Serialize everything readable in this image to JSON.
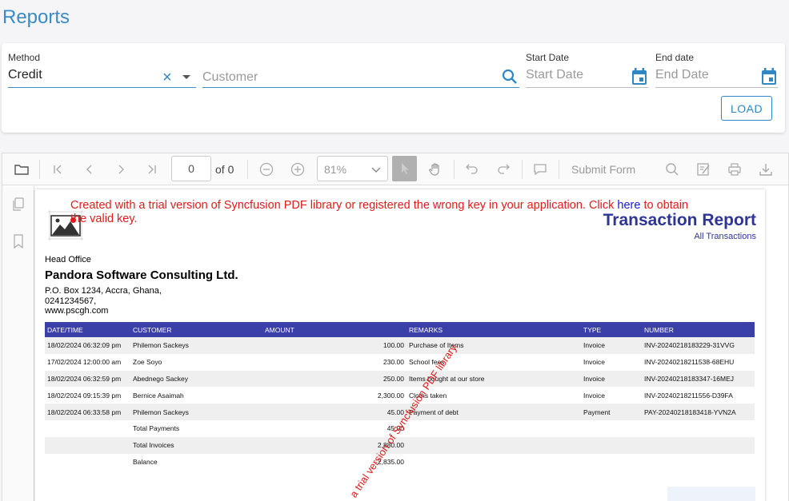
{
  "page": {
    "title": "Reports"
  },
  "filters": {
    "method": {
      "label": "Method",
      "value": "Credit"
    },
    "customer": {
      "placeholder": "Customer"
    },
    "start_date": {
      "label": "Start Date",
      "placeholder": "Start Date"
    },
    "end_date": {
      "label": "End date",
      "placeholder": "End Date"
    },
    "load_label": "LOAD"
  },
  "viewer": {
    "current_page": "0",
    "of_pages": "of 0",
    "zoom": "81%",
    "submit_form_label": "Submit Form"
  },
  "pdf": {
    "trial_notice_before": "Created with a trial version of Syncfusion PDF library or registered the wrong key in your application. Click ",
    "trial_notice_link": "here",
    "trial_notice_after": " to obtain the valid key.",
    "watermark": "a trial version of Syncfusion PDF library.",
    "report_title": "Transaction Report",
    "report_subtitle": "All Transactions",
    "head_office": "Head Office",
    "company_name": "Pandora Software Consulting Ltd.",
    "address_lines": [
      "P.O. Box 1234, Accra, Ghana,",
      "0241234567,",
      "www.pscgh.com"
    ],
    "columns": [
      "DATE/TIME",
      "CUSTOMER",
      "AMOUNT",
      "REMARKS",
      "TYPE",
      "NUMBER"
    ],
    "rows": [
      [
        "18/02/2024 06:32:09 pm",
        "Philemon Sackeys",
        "100.00",
        "Purchase of Items",
        "Invoice",
        "INV-20240218183229-31VVG"
      ],
      [
        "17/02/2024 12:00:00 am",
        "Zoe Soyo",
        "230.00",
        "School fees",
        "Invoice",
        "INV-20240218211538-68EHU"
      ],
      [
        "18/02/2024 06:32:59 pm",
        "Abednego Sackey",
        "250.00",
        "Items bought at our store",
        "Invoice",
        "INV-20240218183347-16MEJ"
      ],
      [
        "18/02/2024 09:15:39 pm",
        "Bernice Asaimah",
        "2,300.00",
        "Cloths taken",
        "Invoice",
        "INV-20240218211556-D39FA"
      ],
      [
        "18/02/2024 06:33:58 pm",
        "Philemon Sackeys",
        "45.00",
        "Payment of debt",
        "Payment",
        "PAY-20240218183418-YVN2A"
      ]
    ],
    "summary": [
      [
        "Total Payments",
        "45.00"
      ],
      [
        "Total Invoices",
        "2,880.00"
      ],
      [
        "Balance",
        "-2,835.00"
      ]
    ]
  },
  "colors": {
    "accent": "#3b8bc4",
    "table_header": "#3b3fa8",
    "report_title": "#2e3596",
    "trial_red": "#e31b1b"
  }
}
